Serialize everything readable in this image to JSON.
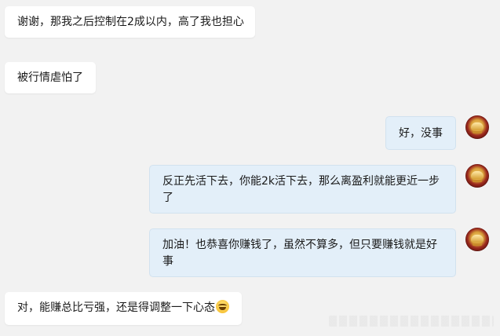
{
  "messages": [
    {
      "side": "left",
      "text": "谢谢，那我之后控制在2成以内，高了我也担心"
    },
    {
      "side": "left",
      "text": "被行情虐怕了"
    },
    {
      "side": "right",
      "text": "好，没事",
      "avatar": "gold-ingot-avatar-icon"
    },
    {
      "side": "right",
      "text": "反正先活下去，你能2k活下去，那么离盈利就能更近一步了",
      "avatar": "gold-ingot-avatar-icon"
    },
    {
      "side": "right",
      "text": "加油！也恭喜你赚钱了，虽然不算多，但只要赚钱就是好事",
      "avatar": "gold-ingot-avatar-icon"
    },
    {
      "side": "left",
      "text": "对，能赚总比亏强，还是得调整一下心态",
      "emoji": "laughing-tears-emoji-icon"
    }
  ],
  "colors": {
    "background": "#f2f2f2",
    "left_bubble": "#ffffff",
    "right_bubble": "#e3eff9"
  }
}
